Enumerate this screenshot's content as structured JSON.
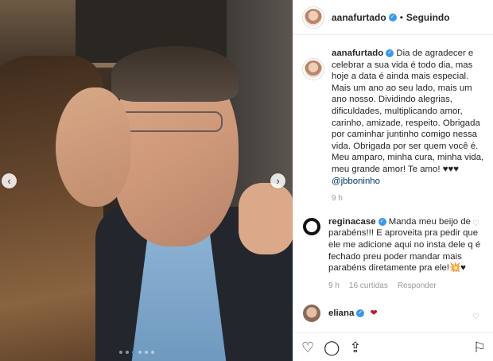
{
  "post": {
    "username": "aanafurtado",
    "follow_sep": "•",
    "follow_status": "Seguindo"
  },
  "caption": {
    "username": "aanafurtado",
    "text": "Dia de agradecer e celebrar a sua vida é todo dia, mas hoje a data é ainda mais especial. Mais um ano ao seu lado, mais um ano nosso. Dividindo alegrias, dificuldades, multiplicando amor, carinho, amizade, respeito. Obrigada por caminhar juntinho comigo nessa vida. Obrigada por ser quem você é. Meu amparo, minha cura, minha vida, meu grande amor! Te amo! ♥♥♥",
    "mention": "@jbboninho",
    "time": "9 h"
  },
  "comments": [
    {
      "username": "reginacase",
      "text": "Manda meu beijo de parabéns!!! E aproveita pra pedir que ele me adicione aqui no insta dele q é fechado preu poder mandar mais parabéns diretamente pra ele!💥♥",
      "time": "9 h",
      "likes": "16 curtidas",
      "reply": "Responder"
    },
    {
      "username": "eliana",
      "text": "❤"
    }
  ],
  "icons": {
    "like": "heart-icon",
    "comment": "comment-icon",
    "share": "share-icon",
    "save": "bookmark-icon"
  },
  "colors": {
    "verified": "#3897f0",
    "link": "#003569",
    "muted": "#999999"
  }
}
